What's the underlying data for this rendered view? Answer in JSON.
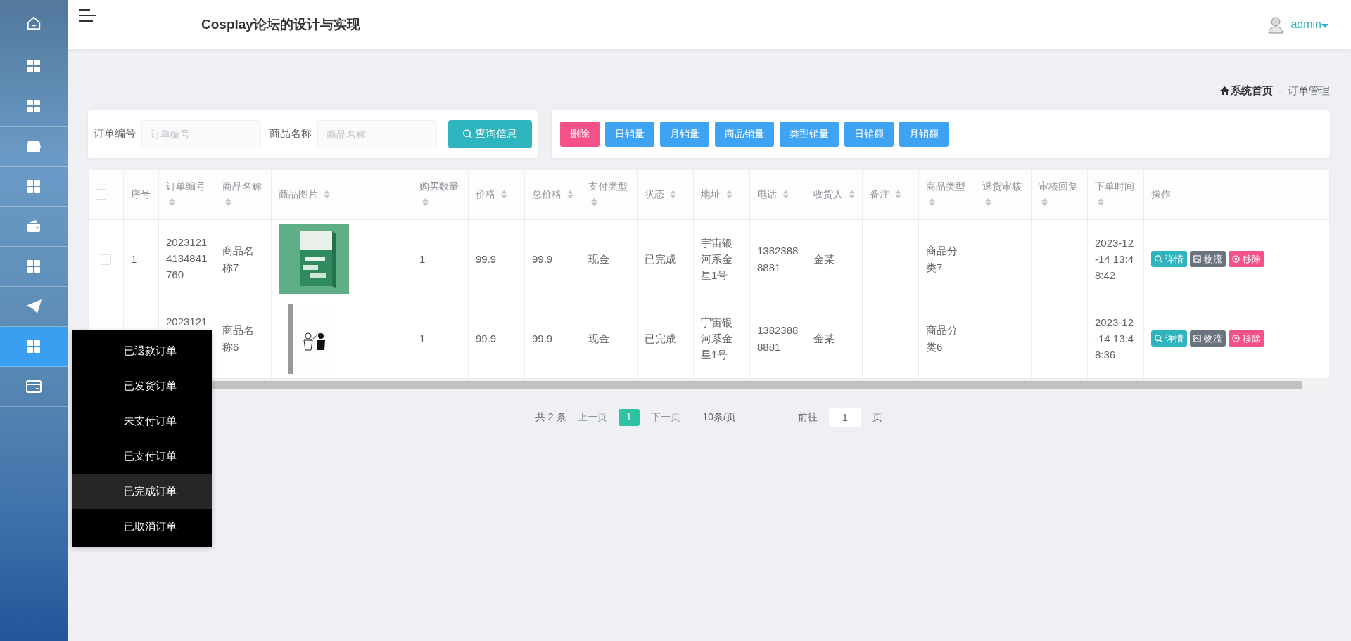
{
  "header": {
    "title": "Cosplay论坛的设计与实现",
    "user": "admin"
  },
  "sidebar": {
    "items": [
      {
        "selected": false
      },
      {
        "selected": false
      },
      {
        "selected": false
      },
      {
        "selected": false
      },
      {
        "selected": false
      },
      {
        "selected": false
      },
      {
        "selected": false
      },
      {
        "selected": false
      },
      {
        "selected": true
      },
      {
        "selected": false
      }
    ]
  },
  "breadcrumb": {
    "home": "系统首页",
    "separator": "-",
    "current": "订单管理"
  },
  "search": {
    "fields": [
      {
        "label": "订单编号",
        "placeholder": "订单编号"
      },
      {
        "label": "商品名称",
        "placeholder": "商品名称"
      }
    ],
    "button": "查询信息"
  },
  "actions": [
    {
      "label": "删除",
      "kind": "danger"
    },
    {
      "label": "日销量",
      "kind": "primary"
    },
    {
      "label": "月销量",
      "kind": "primary"
    },
    {
      "label": "商品销量",
      "kind": "primary"
    },
    {
      "label": "类型销量",
      "kind": "primary"
    },
    {
      "label": "日销额",
      "kind": "primary"
    },
    {
      "label": "月销额",
      "kind": "primary"
    }
  ],
  "table": {
    "columns": [
      {
        "kind": "select",
        "checked": false
      },
      {
        "label": "序号",
        "sortable": false
      },
      {
        "label": "订单编号",
        "sortable": true
      },
      {
        "label": "商品名称",
        "sortable": true
      },
      {
        "label": "商品图片",
        "sortable": true
      },
      {
        "label": "购买数量",
        "sortable": true
      },
      {
        "label": "价格",
        "sortable": true
      },
      {
        "label": "总价格",
        "sortable": true
      },
      {
        "label": "支付类型",
        "sortable": true
      },
      {
        "label": "状态",
        "sortable": true
      },
      {
        "label": "地址",
        "sortable": true
      },
      {
        "label": "电话",
        "sortable": true
      },
      {
        "label": "收货人",
        "sortable": true
      },
      {
        "label": "备注",
        "sortable": true
      },
      {
        "label": "商品类型",
        "sortable": true
      },
      {
        "label": "退货审核",
        "sortable": true
      },
      {
        "label": "审核回复",
        "sortable": true
      },
      {
        "label": "下单时间",
        "sortable": true
      },
      {
        "label": "操作",
        "sortable": false
      }
    ],
    "rows": [
      {
        "checked": false,
        "index": "1",
        "order_no": "20231214134841760",
        "product": "商品名称7",
        "qty": "1",
        "price": "99.9",
        "total": "99.9",
        "pay": "现金",
        "status": "已完成",
        "address": "宇宙银河系金星1号",
        "phone": "13823888881",
        "consignee": "金某",
        "category": "商品分类7",
        "time": "2023-12-14 13:48:42",
        "buttons": [
          {
            "label": "详情",
            "kind": "info"
          },
          {
            "label": "物流",
            "kind": "secondary"
          },
          {
            "label": "移除",
            "kind": "danger"
          }
        ]
      },
      {
        "order_no": "2023121",
        "product": "商品名称6",
        "qty": "1",
        "price": "99.9",
        "total": "99.9",
        "pay": "现金",
        "status": "已完成",
        "address": "宇宙银河系金星1号",
        "phone": "13823888881",
        "consignee": "金某",
        "category": "商品分类6",
        "time": "2023-12-14 13:48:36",
        "buttons": [
          {
            "label": "详情",
            "kind": "info"
          },
          {
            "label": "物流",
            "kind": "secondary"
          },
          {
            "label": "移除",
            "kind": "danger"
          }
        ]
      }
    ]
  },
  "pagination": {
    "total": "共 2 条",
    "prev": "上一页",
    "pages": [
      {
        "label": "1",
        "selected": true
      }
    ],
    "next": "下一页",
    "page_size": "10条/页",
    "goto": "前往",
    "goto_value": "1",
    "page_unit": "页"
  },
  "menu": {
    "items": [
      {
        "label": "已退款订单",
        "highlighted": false
      },
      {
        "label": "已发货订单",
        "highlighted": false
      },
      {
        "label": "未支付订单",
        "highlighted": false
      },
      {
        "label": "已支付订单",
        "highlighted": false
      },
      {
        "label": "已完成订单",
        "highlighted": true
      },
      {
        "label": "已取消订单",
        "highlighted": false
      }
    ]
  }
}
